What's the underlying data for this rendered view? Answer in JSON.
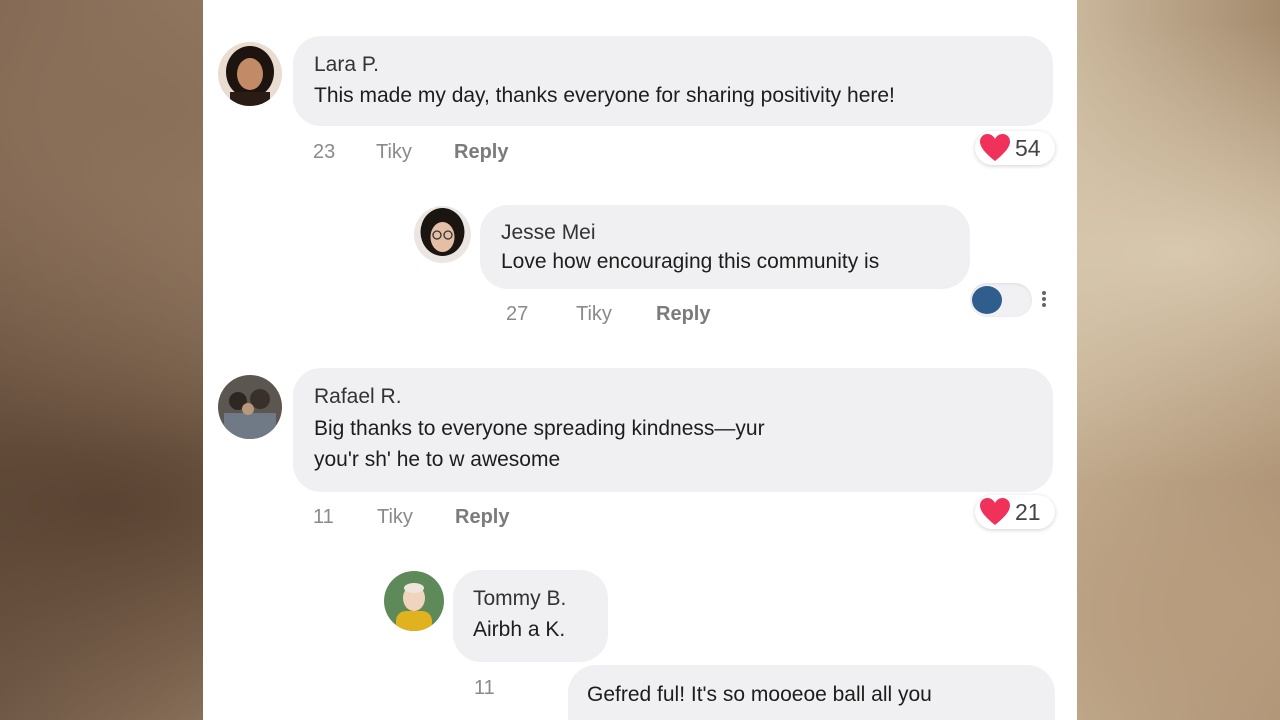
{
  "comments": [
    {
      "author": "Lara P.",
      "text": "This made my day, thanks everyone for sharing positivity here!",
      "time": "23",
      "like_label": "Tiky",
      "reply_label": "Reply",
      "reaction_count": "54"
    },
    {
      "author": "Jesse Mei",
      "text": "Love how encouraging this community is",
      "time": "27",
      "like_label": "Tiky",
      "reply_label": "Reply"
    },
    {
      "author": "Rafael R.",
      "text_line1": "Big thanks to everyone spreading kindness—yur",
      "text_line2": "you'r sh' he to w awesome",
      "time": "11",
      "like_label": "Tiky",
      "reply_label": "Reply",
      "reaction_count": "21"
    },
    {
      "author": "Tommy B.",
      "text": "Airbh a K.",
      "time": "11"
    },
    {
      "text": "Gefred ful! It's so mooeoe ball all you"
    }
  ],
  "icons": [
    "heart-icon",
    "chat-bubble-icon",
    "more-vertical-icon"
  ],
  "colors": {
    "heart": "#f0325a",
    "toggle_knob": "#2f5d8e",
    "bubble": "#f0f0f2"
  }
}
